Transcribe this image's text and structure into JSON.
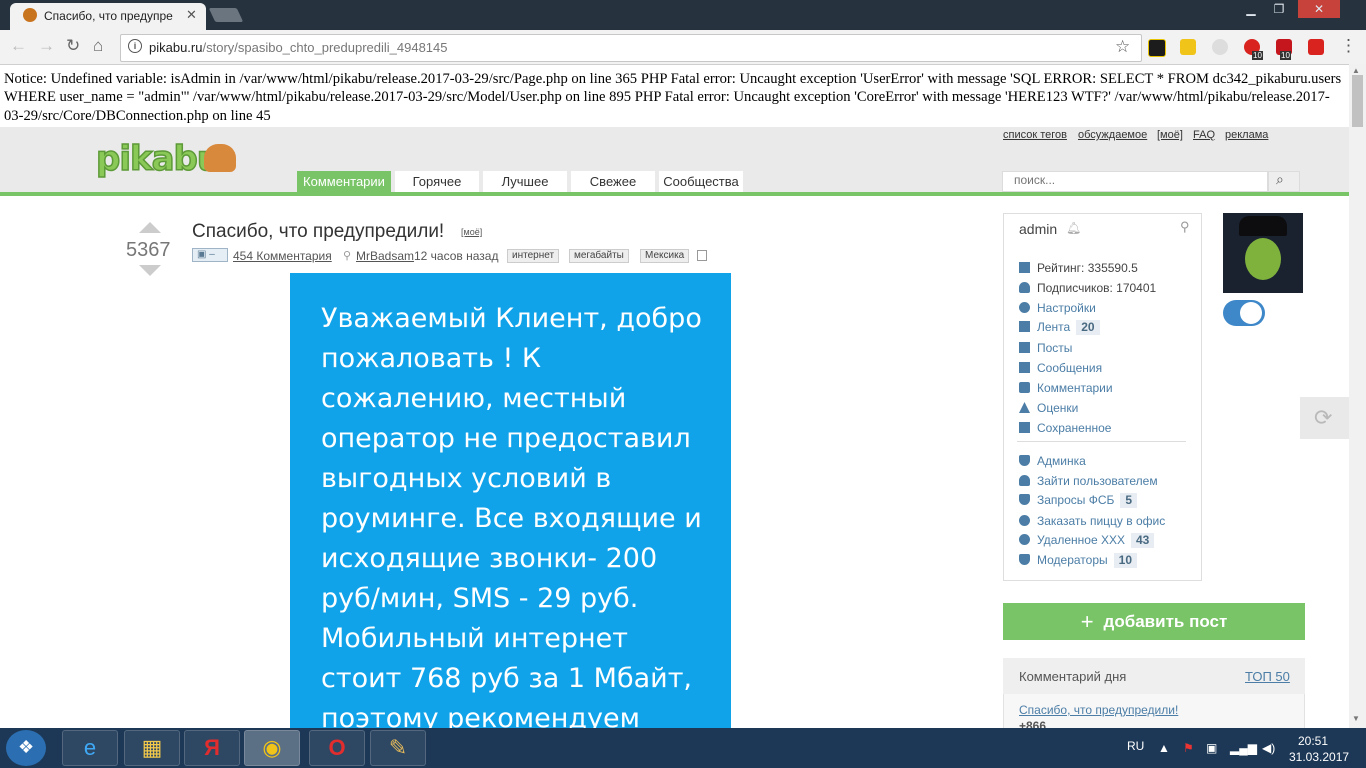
{
  "browser": {
    "tab_title": "Спасибо, что предупре",
    "url_host": "pikabu.ru",
    "url_path": "/story/spasibo_chto_predupredili_4948145",
    "ext_badges": [
      "10",
      "10"
    ]
  },
  "notice": "Notice: Undefined variable: isAdmin in /var/www/html/pikabu/release.2017-03-29/src/Page.php on line 365 PHP Fatal error: Uncaught exception 'UserError' with message 'SQL ERROR: SELECT * FROM dc342_pikaburu.users WHERE user_name = \"admin\"' /var/www/html/pikabu/release.2017-03-29/src/Model/User.php on line 895 PHP Fatal error: Uncaught exception 'CoreError' with message 'HERE123 WTF?' /var/www/html/pikabu/release.2017-03-29/src/Core/DBConnection.php on line 45",
  "header": {
    "logo": "pikabu",
    "top_links": [
      "список тегов",
      "обсуждаемое",
      "[моё]",
      "FAQ",
      "реклама"
    ],
    "tabs": [
      "Комментарии",
      "Горячее",
      "Лучшее",
      "Свежее",
      "Сообщества"
    ],
    "search_placeholder": "поиск..."
  },
  "post": {
    "rating": "5367",
    "title": "Спасибо, что предупредили!",
    "moe_tag": "[моё]",
    "camera_label": "–",
    "comments": "454 Комментария",
    "author": "MrBadsam",
    "time": "12 часов назад",
    "tags": [
      "интернет",
      "мегабайты",
      "Мексика"
    ],
    "image_text": "Уважаемый Клиент, добро пожаловать ! К сожалению, местный оператор не предоставил выгодных условий в роуминге. Все входящие и исходящие звонки- 200 руб/мин, SMS - 29 руб. Мобильный интернет стоит 768 руб за 1 Мбайт, поэтому рекомендуем"
  },
  "user_panel": {
    "username": "admin",
    "rating": "Рейтинг: 335590.5",
    "subscribers": "Подписчиков: 170401",
    "menu1": [
      {
        "label": "Настройки",
        "badge": ""
      },
      {
        "label": "Лента",
        "badge": "20"
      },
      {
        "label": "Посты",
        "badge": ""
      },
      {
        "label": "Сообщения",
        "badge": ""
      },
      {
        "label": "Комментарии",
        "badge": ""
      },
      {
        "label": "Оценки",
        "badge": ""
      },
      {
        "label": "Сохраненное",
        "badge": ""
      }
    ],
    "menu2": [
      {
        "label": "Админка",
        "badge": ""
      },
      {
        "label": "Зайти пользователем",
        "badge": ""
      },
      {
        "label": "Запросы ФСБ",
        "badge": "5"
      },
      {
        "label": "Заказать пиццу в офис",
        "badge": ""
      },
      {
        "label": "Удаленное XXX",
        "badge": "43"
      },
      {
        "label": "Модераторы",
        "badge": "10"
      }
    ]
  },
  "sidebar": {
    "add_post": "добавить пост",
    "cotd_title": "Комментарий дня",
    "top50": "ТОП 50",
    "cotd_link": "Спасибо, что предупредили!",
    "cotd_score": "+866"
  },
  "taskbar": {
    "lang": "RU",
    "time": "20:51",
    "date": "31.03.2017"
  },
  "colors": {
    "green": "#79c467",
    "link_blue": "#4b7da6",
    "post_image_blue": "#11a3ea",
    "taskbar": "#1d3856"
  }
}
